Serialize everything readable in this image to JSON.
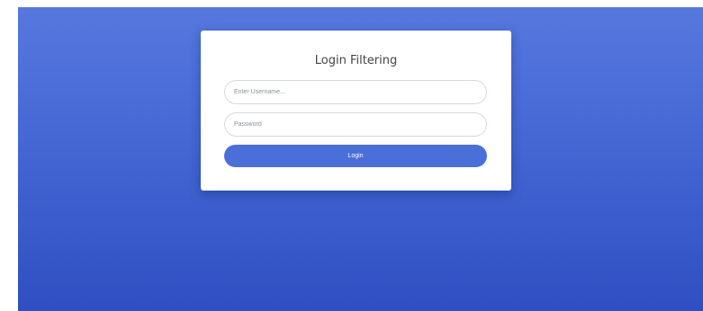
{
  "login": {
    "title": "Login Filtering",
    "username_placeholder": "Enter Username...",
    "username_value": "",
    "password_placeholder": "Password",
    "password_value": "",
    "button_label": "Login"
  },
  "colors": {
    "background_top": "#5678de",
    "background_bottom": "#2f4fc2",
    "button": "#4a6fd8",
    "card": "#ffffff"
  }
}
